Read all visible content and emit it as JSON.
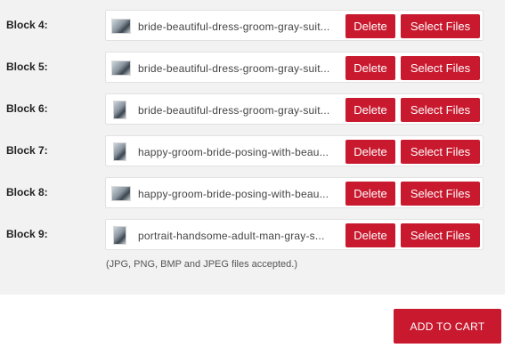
{
  "blocks": [
    {
      "label": "Block 4:",
      "file_name": "bride-beautiful-dress-groom-gray-suit...",
      "thumb_icon": "wedding-photo-thumbnail",
      "thumb_shape": "wide"
    },
    {
      "label": "Block 5:",
      "file_name": "bride-beautiful-dress-groom-gray-suit...",
      "thumb_icon": "wedding-photo-thumbnail",
      "thumb_shape": "wide"
    },
    {
      "label": "Block 6:",
      "file_name": "bride-beautiful-dress-groom-gray-suit...",
      "thumb_icon": "wedding-photo-thumbnail",
      "thumb_shape": "tall"
    },
    {
      "label": "Block 7:",
      "file_name": "happy-groom-bride-posing-with-beau...",
      "thumb_icon": "wedding-photo-thumbnail",
      "thumb_shape": "tall"
    },
    {
      "label": "Block 8:",
      "file_name": "happy-groom-bride-posing-with-beau...",
      "thumb_icon": "wedding-photo-thumbnail",
      "thumb_shape": "wide"
    },
    {
      "label": "Block 9:",
      "file_name": "portrait-handsome-adult-man-gray-s...",
      "thumb_icon": "portrait-photo-thumbnail",
      "thumb_shape": "tall"
    }
  ],
  "buttons": {
    "delete_label": "Delete",
    "select_label": "Select Files"
  },
  "note": "(JPG, PNG, BMP and JPEG files accepted.)",
  "add_to_cart": "ADD TO CART",
  "colors": {
    "accent": "#c8192e",
    "panel_bg": "#f2f2f2",
    "field_border": "#e2e2e2"
  }
}
